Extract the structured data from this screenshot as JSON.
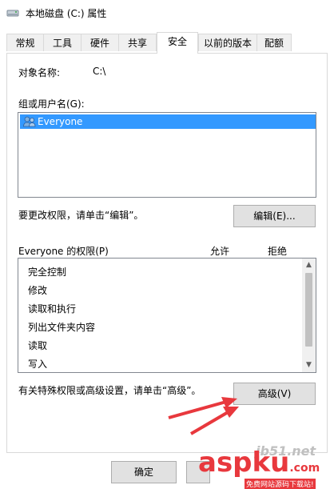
{
  "window": {
    "title": "本地磁盘 (C:) 属性"
  },
  "tabs": [
    {
      "label": "常规"
    },
    {
      "label": "工具"
    },
    {
      "label": "硬件"
    },
    {
      "label": "共享"
    },
    {
      "label": "安全"
    },
    {
      "label": "以前的版本"
    },
    {
      "label": "配额"
    }
  ],
  "active_tab": "安全",
  "object": {
    "label": "对象名称:",
    "value": "C:\\"
  },
  "groups": {
    "label": "组或用户名(G):",
    "items": [
      {
        "name": "Everyone",
        "selected": true
      }
    ]
  },
  "edit": {
    "hint": "要更改权限，请单击“编辑”。",
    "button": "编辑(E)..."
  },
  "permissions": {
    "header": "Everyone 的权限(P)",
    "allow": "允许",
    "deny": "拒绝",
    "items": [
      "完全控制",
      "修改",
      "读取和执行",
      "列出文件夹内容",
      "读取",
      "写入"
    ]
  },
  "advanced": {
    "hint": "有关特殊权限或高级设置，请单击“高级”。",
    "button": "高级(V)"
  },
  "footer": {
    "ok": "确定"
  },
  "watermark": {
    "brand": "aspku",
    "suffix": ".com",
    "site": "jb51.net",
    "caption": "免费网站源码下载站!"
  },
  "colors": {
    "selection": "#3399ff",
    "arrow": "#e8383d",
    "brand_red": "#e8383d"
  }
}
